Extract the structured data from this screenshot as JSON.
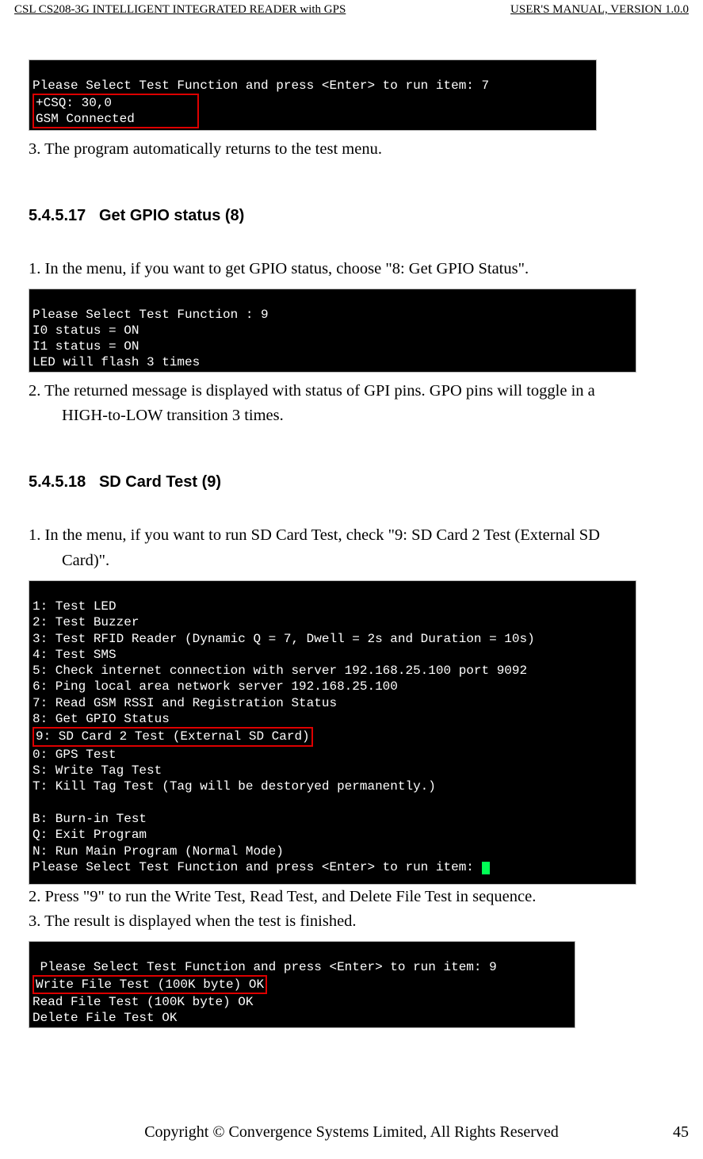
{
  "header": {
    "left": "CSL CS208-3G INTELLIGENT INTEGRATED READER with GPS",
    "right": "USER'S  MANUAL,  VERSION  1.0.0"
  },
  "footer": {
    "center": "Copyright © Convergence Systems Limited, All Rights Reserved",
    "page": "45"
  },
  "term1": {
    "l1": "Please Select Test Function and press <Enter> to run item: 7",
    "box_l1": "+CSQ: 30,0           ",
    "box_l2": "GSM Connected        "
  },
  "step_3_return": "3. The program automatically returns to the test menu.",
  "sec17": {
    "num": "5.4.5.17",
    "title": "Get GPIO status (8)",
    "step1": "1. In the menu, if you want to get GPIO status, choose \"8: Get GPIO Status\".",
    "step2_a": "2. The returned message is displayed with status of GPI pins. GPO pins will toggle in a",
    "step2_b": "HIGH-to-LOW transition 3 times."
  },
  "term2": {
    "l1": "Please Select Test Function : 9",
    "l2": "I0 status = ON",
    "l3": "I1 status = ON",
    "l4": "LED will flash 3 times"
  },
  "sec18": {
    "num": "5.4.5.18",
    "title": "SD Card Test (9)",
    "step1_a": "1. In the menu, if you want to run SD Card Test, check \"9: SD Card 2 Test (External SD",
    "step1_b": "Card)\".",
    "step2": "2. Press \"9\" to run the Write Test, Read Test, and Delete File Test in sequence.",
    "step3": "3. The result is displayed when the test is finished."
  },
  "term3": {
    "l1": "1: Test LED",
    "l2": "2: Test Buzzer",
    "l3": "3: Test RFID Reader (Dynamic Q = 7, Dwell = 2s and Duration = 10s)",
    "l4": "4: Test SMS",
    "l5": "5: Check internet connection with server 192.168.25.100 port 9092",
    "l6": "6: Ping local area network server 192.168.25.100",
    "l7": "7: Read GSM RSSI and Registration Status",
    "l8": "8: Get GPIO Status",
    "l9": "9: SD Card 2 Test (External SD Card)",
    "l10": "0: GPS Test",
    "l11": "S: Write Tag Test",
    "l12": "T: Kill Tag Test (Tag will be destoryed permanently.)",
    "l13": "",
    "l14": "B: Burn-in Test",
    "l15": "Q: Exit Program",
    "l16": "N: Run Main Program (Normal Mode)",
    "l17": "Please Select Test Function and press <Enter> to run item: "
  },
  "term4": {
    "l1": " Please Select Test Function and press <Enter> to run item: 9",
    "box_l1": "Write File Test (100K byte) OK",
    "l3": "Read File Test (100K byte) OK",
    "l4": "Delete File Test OK"
  }
}
